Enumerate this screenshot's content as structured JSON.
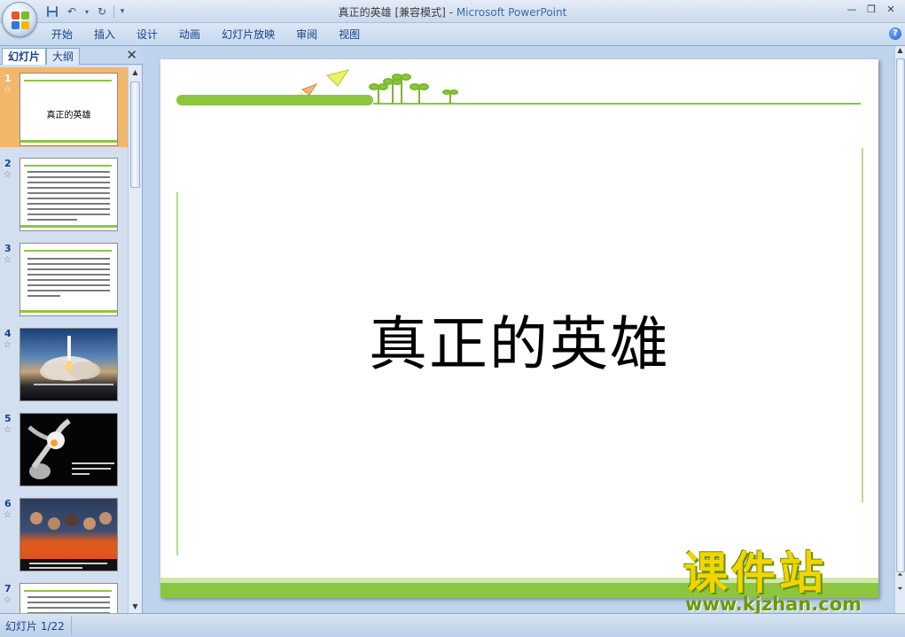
{
  "window": {
    "title": "真正的英雄 [兼容模式]",
    "app_name": "Microsoft PowerPoint",
    "title_separator": " - "
  },
  "ribbon": {
    "tabs": [
      "开始",
      "插入",
      "设计",
      "动画",
      "幻灯片放映",
      "审阅",
      "视图"
    ]
  },
  "left_panel": {
    "tabs": {
      "slides": "幻灯片",
      "outline": "大纲"
    },
    "thumbnails": [
      {
        "number": "1",
        "title": "真正的英雄",
        "kind": "title"
      },
      {
        "number": "2",
        "kind": "text"
      },
      {
        "number": "3",
        "kind": "text"
      },
      {
        "number": "4",
        "kind": "photo"
      },
      {
        "number": "5",
        "kind": "photo"
      },
      {
        "number": "6",
        "kind": "photo"
      },
      {
        "number": "7",
        "kind": "text"
      }
    ],
    "selected": "1"
  },
  "slide": {
    "title": "真正的英雄",
    "accent_color": "#8cc63f"
  },
  "watermark": {
    "text": "课件站",
    "url": "www.kjzhan.com"
  },
  "statusbar": {
    "slide_indicator": "幻灯片 1/22"
  }
}
